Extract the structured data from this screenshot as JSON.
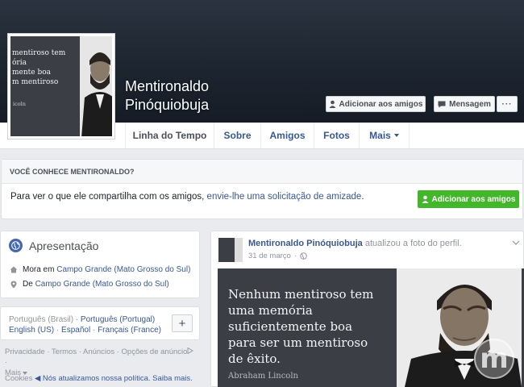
{
  "colors": {
    "link": "#365899",
    "green_button": "#42b72a",
    "page_bg": "#e9ebee",
    "cover_dark": "#1d2530"
  },
  "profile": {
    "name": "Mentironaldo Pinóquiobuja",
    "picture_quote": "mentiroso tem\nória\nmente boa\nm mentiroso",
    "picture_author": "icoln"
  },
  "cover_actions": {
    "add_friend_label": "Adicionar aos amigos",
    "message_label": "Mensagem",
    "more_label": "···"
  },
  "tabs": [
    {
      "label": "Linha do Tempo"
    },
    {
      "label": "Sobre"
    },
    {
      "label": "Amigos"
    },
    {
      "label": "Fotos"
    },
    {
      "label": "Mais"
    }
  ],
  "know_box": {
    "title": "VOCÊ CONHECE MENTIRONALDO?",
    "text_prefix": "Para ver o que ele compartilha com os amigos, ",
    "text_link": "envie-lhe uma solicitação de amizade",
    "text_suffix": ".",
    "button_label": "Adicionar aos amigos"
  },
  "intro": {
    "title": "Apresentação",
    "lives_prefix": "Mora em ",
    "lives_link": "Campo Grande (Mato Grosso do Sul)",
    "from_prefix": "De ",
    "from_link": "Campo Grande (Mato Grosso do Sul)"
  },
  "languages": {
    "current": "Português (Brasil)",
    "sep": " · ",
    "links": [
      "Português (Portugal)",
      "English (US)",
      "Español",
      "Français (France)"
    ],
    "add_label": "+"
  },
  "footer": {
    "links": [
      "Privacidade",
      "Termos",
      "Anúncios",
      "Opções de anúncio"
    ],
    "more": "Mais",
    "cookies_prefix": "Cookies ",
    "cookies_link": "◀ Nós atualizamos nossa política.",
    "cookies_link2": "Saiba mais."
  },
  "post": {
    "author": "Mentironaldo Pinóquiobuja",
    "action": " atualizou a foto do perfil.",
    "date": "31 de março",
    "separator": "·",
    "image_quote": "Nenhum mentiroso tem\numa memória\nsuficientemente boa\npara ser um mentiroso\nde êxito.",
    "image_author": "Abraham Lincoln"
  },
  "icons": {
    "globe": "globe-icon",
    "home": "home-icon",
    "location": "location-pin-icon",
    "person_add": "person-add-icon",
    "message": "message-icon",
    "audience": "globe-audience-icon"
  }
}
